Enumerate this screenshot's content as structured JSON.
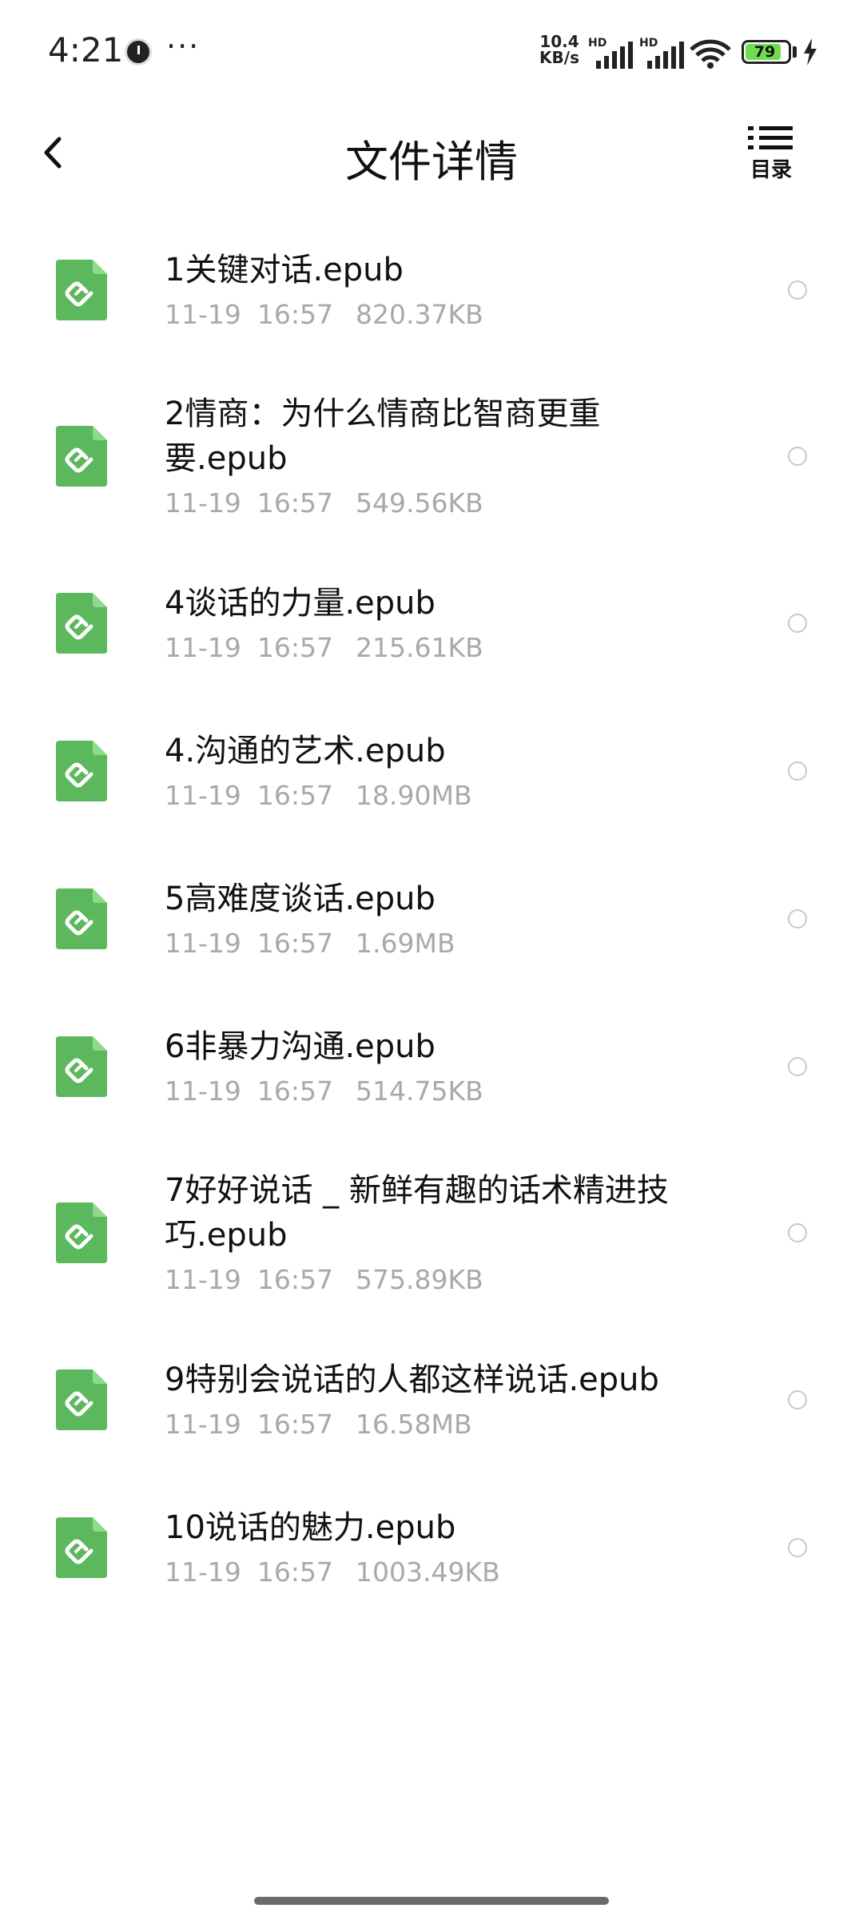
{
  "status_bar": {
    "time": "4:21",
    "more": "···",
    "net_speed_value": "10.4",
    "net_speed_unit": "KB/s",
    "signal_label": "HD",
    "battery_level": "79",
    "icons": [
      "alarm-icon",
      "signal-icon",
      "wifi-icon",
      "battery-icon",
      "charging-icon"
    ]
  },
  "header": {
    "title": "文件详情",
    "toc_label": "目录"
  },
  "files": [
    {
      "name": "1关键对话.epub",
      "date": "11-19",
      "time": "16:57",
      "size": "820.37KB"
    },
    {
      "name": "2情商：为什么情商比智商更重要.epub",
      "date": "11-19",
      "time": "16:57",
      "size": "549.56KB"
    },
    {
      "name": "4谈话的力量.epub",
      "date": "11-19",
      "time": "16:57",
      "size": "215.61KB"
    },
    {
      "name": "4.沟通的艺术.epub",
      "date": "11-19",
      "time": "16:57",
      "size": "18.90MB"
    },
    {
      "name": "5高难度谈话.epub",
      "date": "11-19",
      "time": "16:57",
      "size": "1.69MB"
    },
    {
      "name": "6非暴力沟通.epub",
      "date": "11-19",
      "time": "16:57",
      "size": "514.75KB"
    },
    {
      "name": "7好好说话 _ 新鲜有趣的话术精进技巧.epub",
      "date": "11-19",
      "time": "16:57",
      "size": "575.89KB"
    },
    {
      "name": "9特别会说话的人都这样说话.epub",
      "date": "11-19",
      "time": "16:57",
      "size": "16.58MB"
    },
    {
      "name": "10说话的魅力.epub",
      "date": "11-19",
      "time": "16:57",
      "size": "1003.49KB"
    }
  ],
  "colors": {
    "epub_icon": "#5cb85c",
    "meta_text": "#a8a8ad",
    "battery_fill": "#6fdc52"
  }
}
